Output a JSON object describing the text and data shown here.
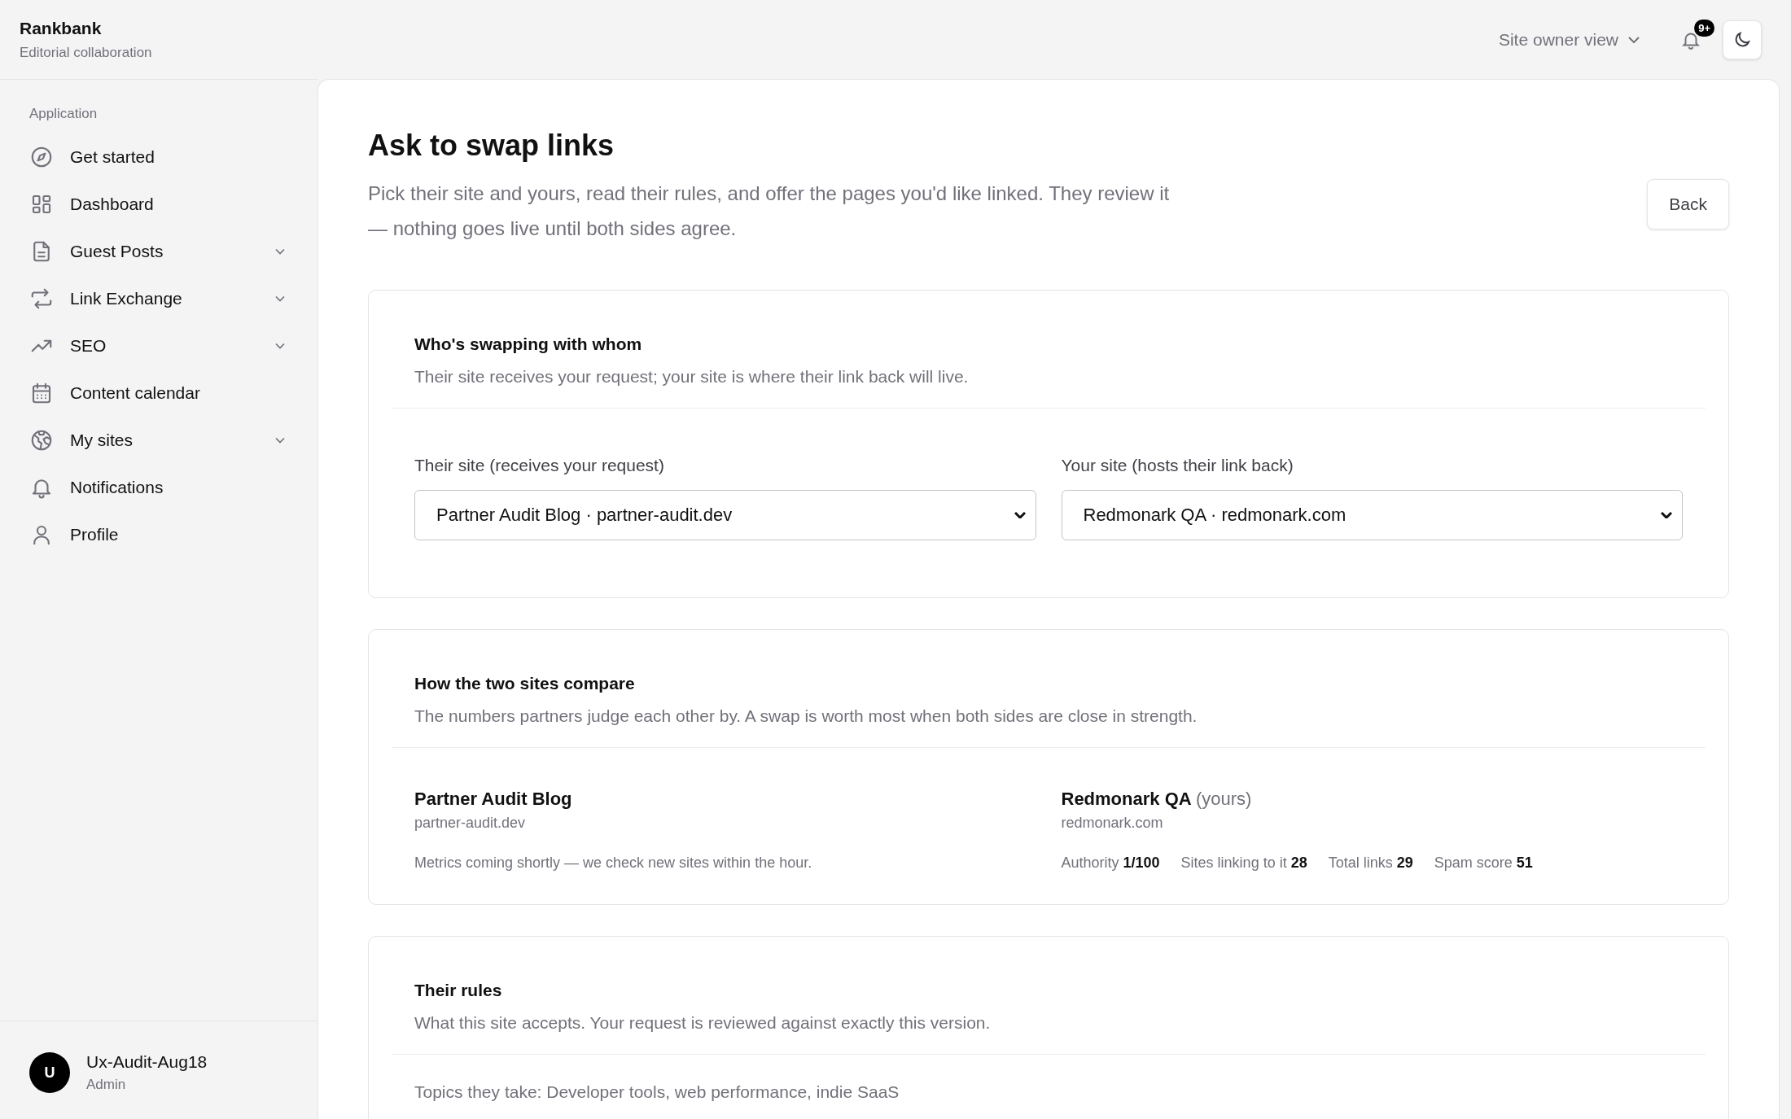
{
  "app": {
    "name": "Rankbank",
    "tagline": "Editorial collaboration"
  },
  "topbar": {
    "view_switch": "Site owner view",
    "notifications_badge": "9+"
  },
  "sidebar": {
    "section": "Application",
    "items": [
      {
        "label": "Get started",
        "expandable": false
      },
      {
        "label": "Dashboard",
        "expandable": false
      },
      {
        "label": "Guest Posts",
        "expandable": true
      },
      {
        "label": "Link Exchange",
        "expandable": true
      },
      {
        "label": "SEO",
        "expandable": true
      },
      {
        "label": "Content calendar",
        "expandable": false
      },
      {
        "label": "My sites",
        "expandable": true
      },
      {
        "label": "Notifications",
        "expandable": false
      },
      {
        "label": "Profile",
        "expandable": false
      }
    ]
  },
  "user": {
    "initial": "U",
    "name": "Ux-Audit-Aug18",
    "role": "Admin"
  },
  "page": {
    "title": "Ask to swap links",
    "description": "Pick their site and yours, read their rules, and offer the pages you'd like linked. They review it — nothing goes live until both sides agree.",
    "back_button": "Back"
  },
  "sections": [
    {
      "kind": "fields",
      "title": "Who's swapping with whom",
      "description": "Their site receives your request; your site is where their link back will live.",
      "fields": [
        {
          "label": "Their site (receives your request)",
          "value": "Partner Audit Blog · partner-audit.dev"
        },
        {
          "label": "Your site (hosts their link back)",
          "value": "Redmonark QA · redmonark.com"
        }
      ]
    },
    {
      "kind": "compare",
      "title": "How the two sites compare",
      "description": "The numbers partners judge each other by. A swap is worth most when both sides are close in strength.",
      "sites": [
        {
          "name": "Partner Audit Blog",
          "domain": "partner-audit.dev",
          "note": "Metrics coming shortly — we check new sites within the hour."
        },
        {
          "name": "Redmonark QA",
          "suffix": "(yours)",
          "domain": "redmonark.com",
          "metrics": [
            {
              "label": "Authority",
              "value": "1/100"
            },
            {
              "label": "Sites linking to it",
              "value": "28"
            },
            {
              "label": "Total links",
              "value": "29"
            },
            {
              "label": "Spam score",
              "value": "51"
            }
          ]
        }
      ]
    },
    {
      "kind": "text",
      "title": "Their rules",
      "description": "What this site accepts. Your request is reviewed against exactly this version.",
      "lines": [
        "Topics they take: Developer tools, web performance, indie SaaS"
      ]
    }
  ]
}
